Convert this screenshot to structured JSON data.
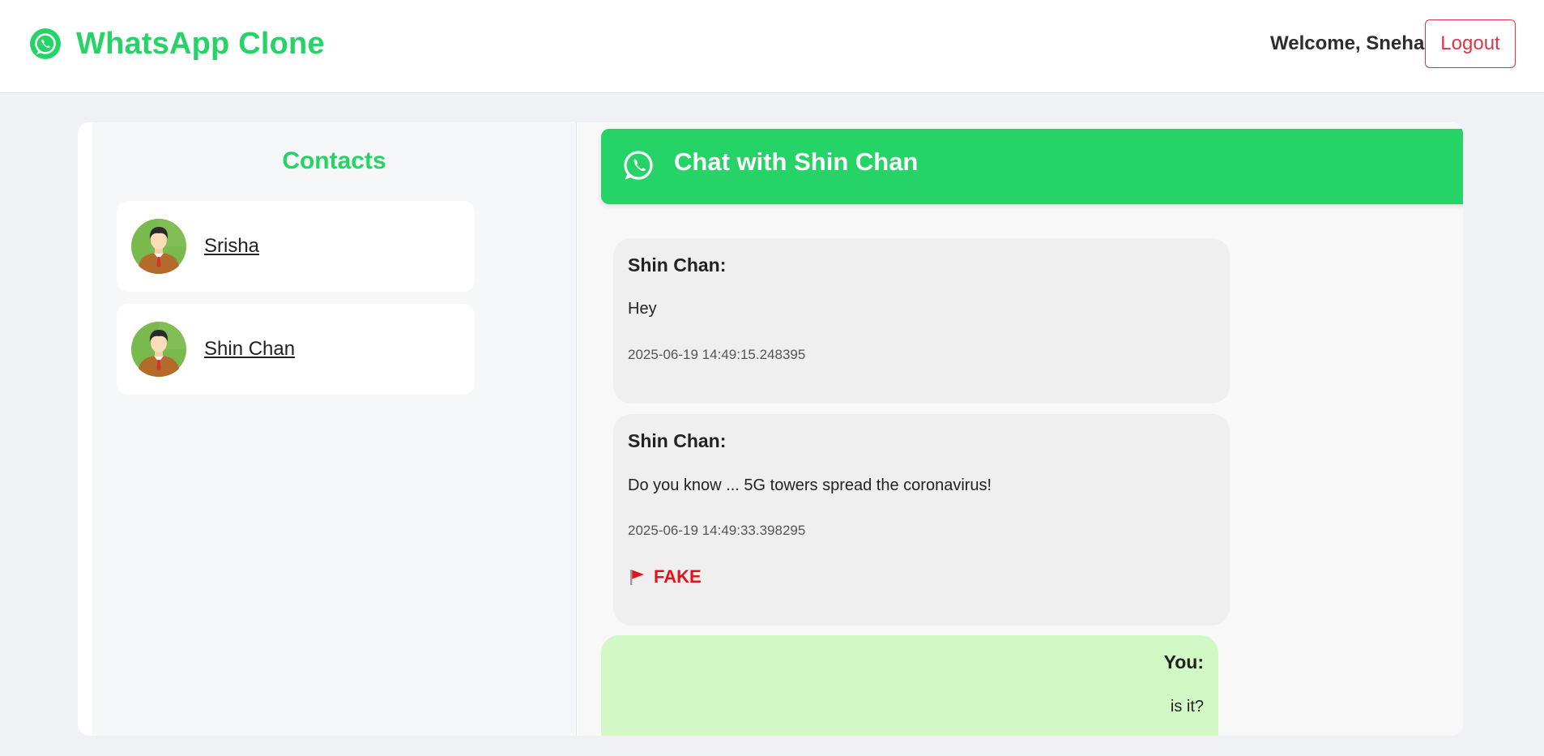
{
  "app": {
    "title": "WhatsApp Clone",
    "welcome": "Welcome, Sneha",
    "logout_label": "Logout",
    "accent_color": "#25d366",
    "logout_color": "#dc3545"
  },
  "contacts": {
    "title": "Contacts",
    "items": [
      {
        "name": "Srisha",
        "avatar": "user-avatar-icon"
      },
      {
        "name": "Shin Chan",
        "avatar": "user-avatar-icon"
      }
    ]
  },
  "chat": {
    "title": "Chat with Shin Chan",
    "header_icon": "whatsapp-icon",
    "messages": [
      {
        "sender": "Shin Chan:",
        "text": "Hey",
        "time": "2025-06-19 14:49:15.248395"
      },
      {
        "sender": "Shin Chan:",
        "text": "Do you know ... 5G towers spread the coronavirus!",
        "time": "2025-06-19 14:49:33.398295",
        "flag": "FAKE",
        "flag_icon": "red-flag-icon",
        "flag_color": "#e0151b"
      },
      {
        "sender": "You:",
        "text": "is it?"
      }
    ]
  }
}
